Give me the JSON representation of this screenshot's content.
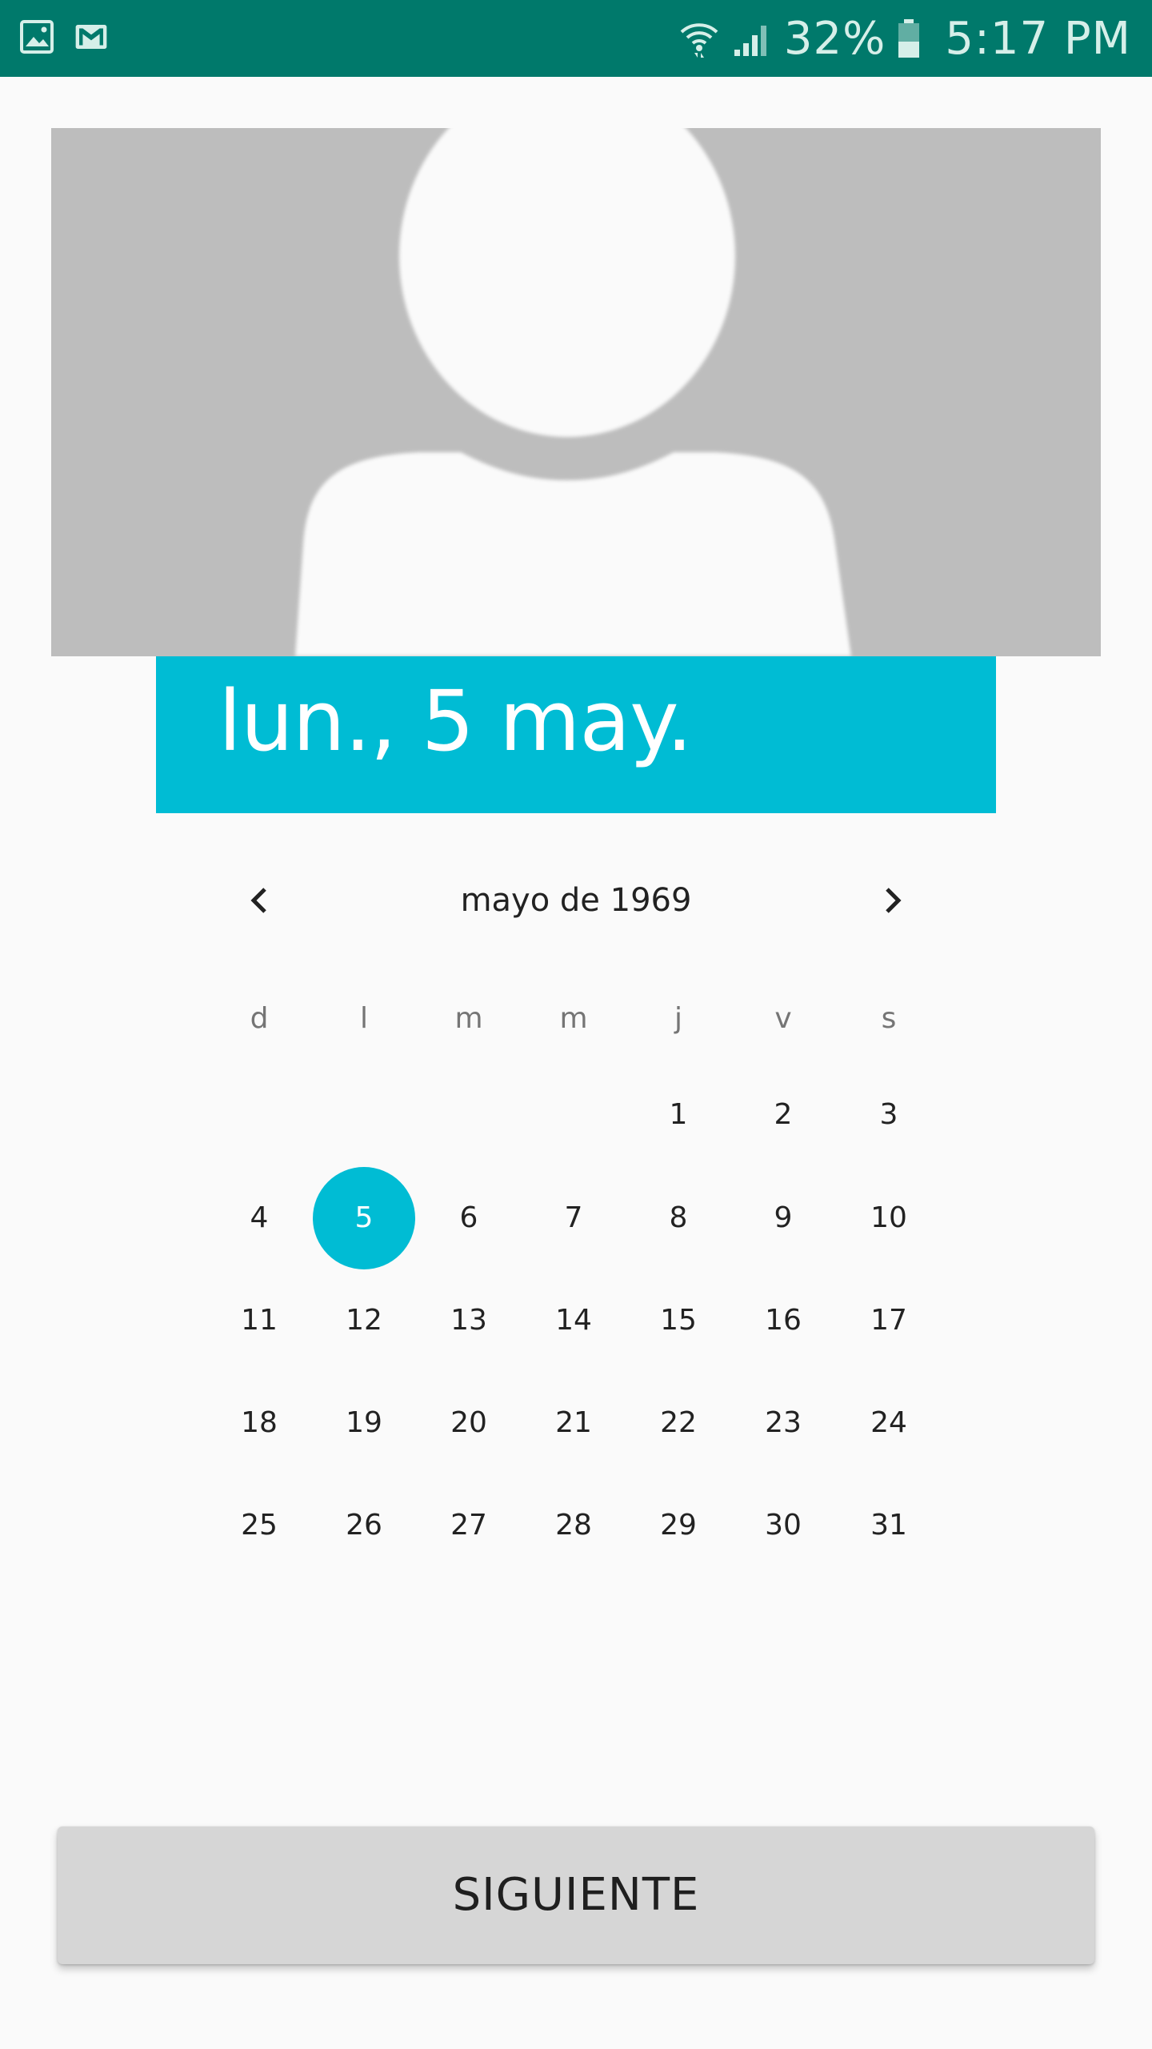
{
  "status_bar": {
    "left_icons": [
      "gallery-icon",
      "gmail-icon"
    ],
    "right_icons": [
      "wifi-icon",
      "cell-signal-icon",
      "battery-icon"
    ],
    "battery": "32%",
    "time": "5:17 PM"
  },
  "profile": {
    "photo_icon": "person-placeholder-icon"
  },
  "date_header": {
    "text": "lun., 5 may."
  },
  "calendar": {
    "month_title": "mayo de 1969",
    "prev_icon": "chevron-left-icon",
    "next_icon": "chevron-right-icon",
    "weekdays": [
      "d",
      "l",
      "m",
      "m",
      "j",
      "v",
      "s"
    ],
    "weeks": [
      [
        "",
        "",
        "",
        "",
        "1",
        "2",
        "3"
      ],
      [
        "4",
        "5",
        "6",
        "7",
        "8",
        "9",
        "10"
      ],
      [
        "11",
        "12",
        "13",
        "14",
        "15",
        "16",
        "17"
      ],
      [
        "18",
        "19",
        "20",
        "21",
        "22",
        "23",
        "24"
      ],
      [
        "25",
        "26",
        "27",
        "28",
        "29",
        "30",
        "31"
      ]
    ],
    "selected_day": "5"
  },
  "actions": {
    "next_label": "SIGUIENTE"
  },
  "colors": {
    "status_bar": "#00796b",
    "accent": "#00bcd4",
    "photo_background": "#bdbdbd",
    "button": "#d6d6d6"
  }
}
